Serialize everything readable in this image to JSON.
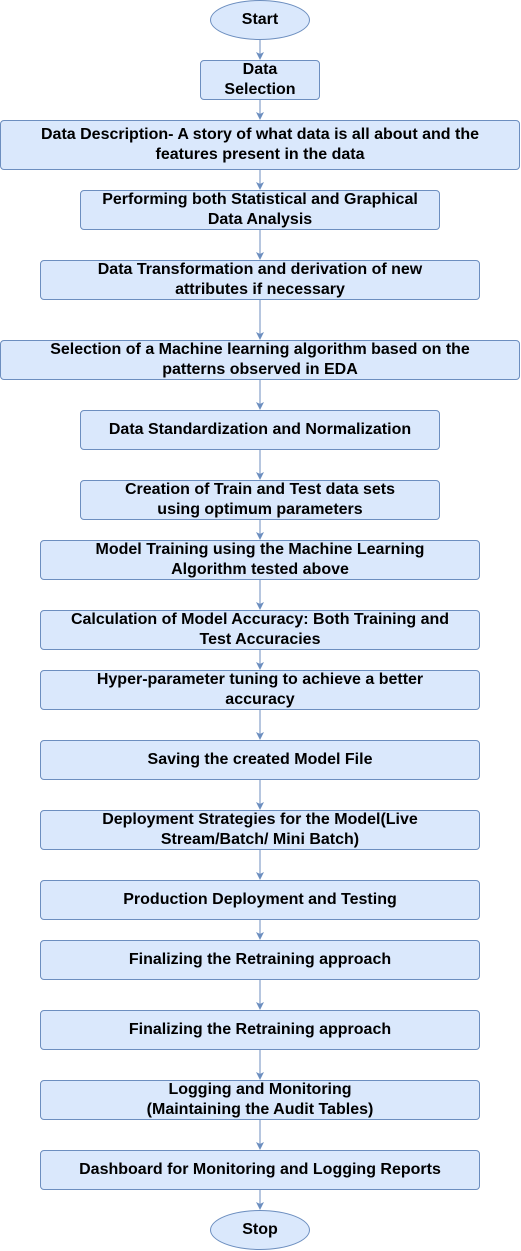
{
  "flowchart": {
    "colors": {
      "fill": "#dae8fc",
      "stroke": "#6c8ebf",
      "text": "#000000"
    },
    "steps": [
      {
        "id": "start",
        "label": "Start",
        "shape": "ellipse"
      },
      {
        "id": "data-selection",
        "label": "Data\nSelection",
        "shape": "rect"
      },
      {
        "id": "data-description",
        "label": "Data Description- A  story of what data is all about and the\nfeatures present in the data",
        "shape": "rect"
      },
      {
        "id": "data-analysis",
        "label": "Performing both Statistical and Graphical\nData Analysis",
        "shape": "rect"
      },
      {
        "id": "data-transformation",
        "label": "Data Transformation and derivation of new\nattributes if necessary",
        "shape": "rect"
      },
      {
        "id": "algorithm-selection",
        "label": "Selection of a Machine learning algorithm based on the\npatterns observed in EDA",
        "shape": "rect"
      },
      {
        "id": "standardization",
        "label": "Data Standardization and Normalization",
        "shape": "rect"
      },
      {
        "id": "train-test-sets",
        "label": "Creation of Train and Test data sets\nusing optimum parameters",
        "shape": "rect"
      },
      {
        "id": "model-training",
        "label": "Model Training  using the Machine Learning\nAlgorithm tested above",
        "shape": "rect"
      },
      {
        "id": "model-accuracy",
        "label": "Calculation of Model Accuracy: Both Training and\nTest Accuracies",
        "shape": "rect"
      },
      {
        "id": "hyperparameter-tuning",
        "label": "Hyper-parameter tuning to achieve a better\naccuracy",
        "shape": "rect"
      },
      {
        "id": "save-model",
        "label": "Saving the created Model File",
        "shape": "rect"
      },
      {
        "id": "deployment-strategies",
        "label": "Deployment Strategies for the Model(Live\nStream/Batch/ Mini Batch)",
        "shape": "rect"
      },
      {
        "id": "production-deployment",
        "label": "Production Deployment and Testing",
        "shape": "rect"
      },
      {
        "id": "retraining-1",
        "label": "Finalizing the Retraining approach",
        "shape": "rect"
      },
      {
        "id": "retraining-2",
        "label": "Finalizing the Retraining approach",
        "shape": "rect"
      },
      {
        "id": "logging-monitoring",
        "label": "Logging and Monitoring\n(Maintaining the Audit Tables)",
        "shape": "rect"
      },
      {
        "id": "dashboard",
        "label": "Dashboard for Monitoring and Logging Reports",
        "shape": "rect"
      },
      {
        "id": "stop",
        "label": "Stop",
        "shape": "ellipse"
      }
    ]
  }
}
